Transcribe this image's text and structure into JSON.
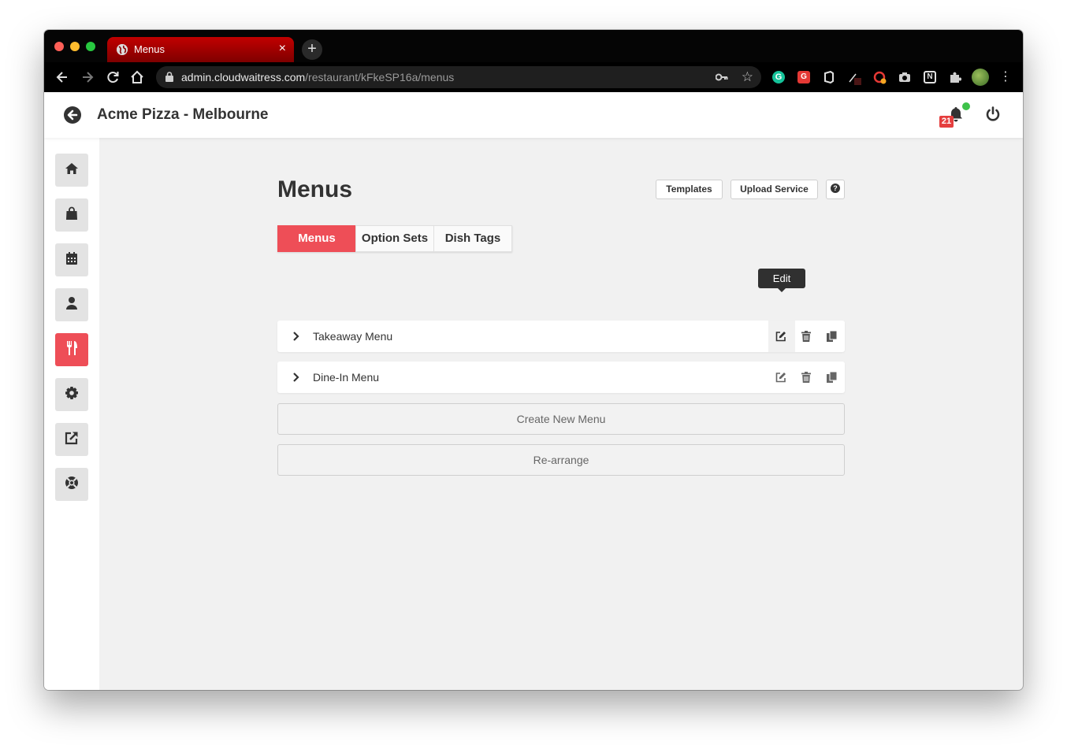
{
  "browser": {
    "tab_title": "Menus",
    "tab_close": "×",
    "new_tab": "+",
    "url_host": "admin.cloudwaitress.com",
    "url_path": "/restaurant/kFkeSP16a/menus",
    "extensions": {
      "grammarly": "G",
      "g2": "G",
      "notion": "N"
    },
    "menu": "⋮"
  },
  "app": {
    "restaurant_name": "Acme Pizza - Melbourne",
    "notification_count": "21",
    "colors": {
      "accent": "#ee4e57",
      "online": "#3ec24a",
      "badge": "#e53e3e"
    }
  },
  "sidebar": {
    "items": [
      {
        "icon": "home-icon"
      },
      {
        "icon": "shopping-bag-icon"
      },
      {
        "icon": "calendar-icon"
      },
      {
        "icon": "user-icon"
      },
      {
        "icon": "utensils-icon",
        "active": true
      },
      {
        "icon": "gear-icon"
      },
      {
        "icon": "external-link-icon"
      },
      {
        "icon": "life-ring-icon"
      }
    ]
  },
  "page": {
    "title": "Menus",
    "buttons": {
      "templates": "Templates",
      "upload_service": "Upload Service",
      "help": "?"
    },
    "tabs": [
      {
        "label": "Menus",
        "active": true
      },
      {
        "label": "Option Sets"
      },
      {
        "label": "Dish Tags"
      }
    ],
    "tooltip": "Edit",
    "menus": [
      {
        "name": "Takeaway Menu"
      },
      {
        "name": "Dine-In Menu"
      }
    ],
    "create_button": "Create New Menu",
    "rearrange_button": "Re-arrange"
  }
}
